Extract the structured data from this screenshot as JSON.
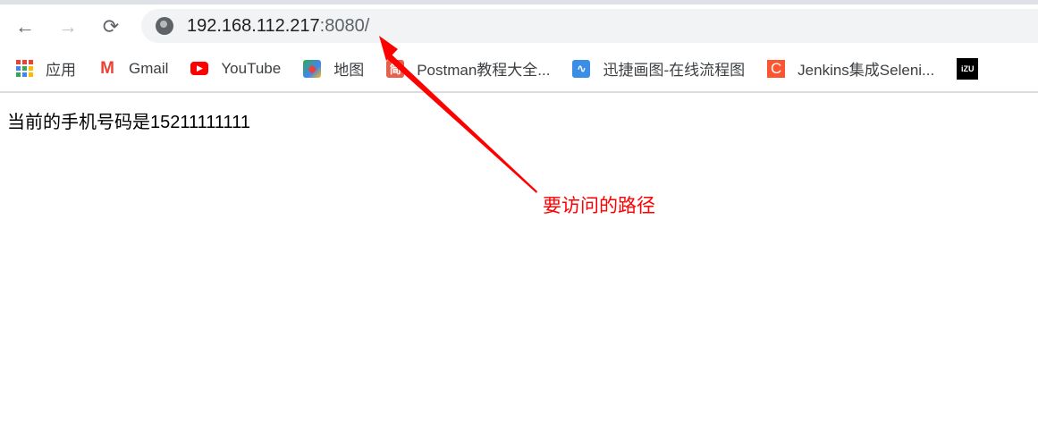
{
  "browser": {
    "url_host": "192.168.112.217",
    "url_port": ":8080/",
    "nav": {
      "back": "←",
      "forward": "→",
      "reload": "⟳"
    },
    "bookmarks": [
      {
        "label": "应用",
        "icon": "apps-grid-icon"
      },
      {
        "label": "Gmail",
        "icon": "gmail-icon",
        "icon_text": "M",
        "color": "#ea4335"
      },
      {
        "label": "YouTube",
        "icon": "youtube-icon",
        "icon_text": "▶",
        "color": "#ff0000"
      },
      {
        "label": "地图",
        "icon": "maps-icon",
        "icon_text": "◆",
        "color": "#34a853"
      },
      {
        "label": "Postman教程大全...",
        "icon": "jian-icon",
        "icon_text": "简",
        "color": "#e8604c"
      },
      {
        "label": "迅捷画图-在线流程图",
        "icon": "xunjie-icon",
        "icon_text": "∿",
        "color": "#3a8ee6"
      },
      {
        "label": "Jenkins集成Seleni...",
        "icon": "c-icon",
        "icon_text": "C",
        "color": "#fc5531"
      },
      {
        "label": "",
        "icon": "izu-icon",
        "icon_text": "iZU",
        "color": "#000000"
      }
    ]
  },
  "page": {
    "text": "当前的手机号码是15211111111"
  },
  "annotation": {
    "text": "要访问的路径",
    "color": "#ff0000"
  }
}
